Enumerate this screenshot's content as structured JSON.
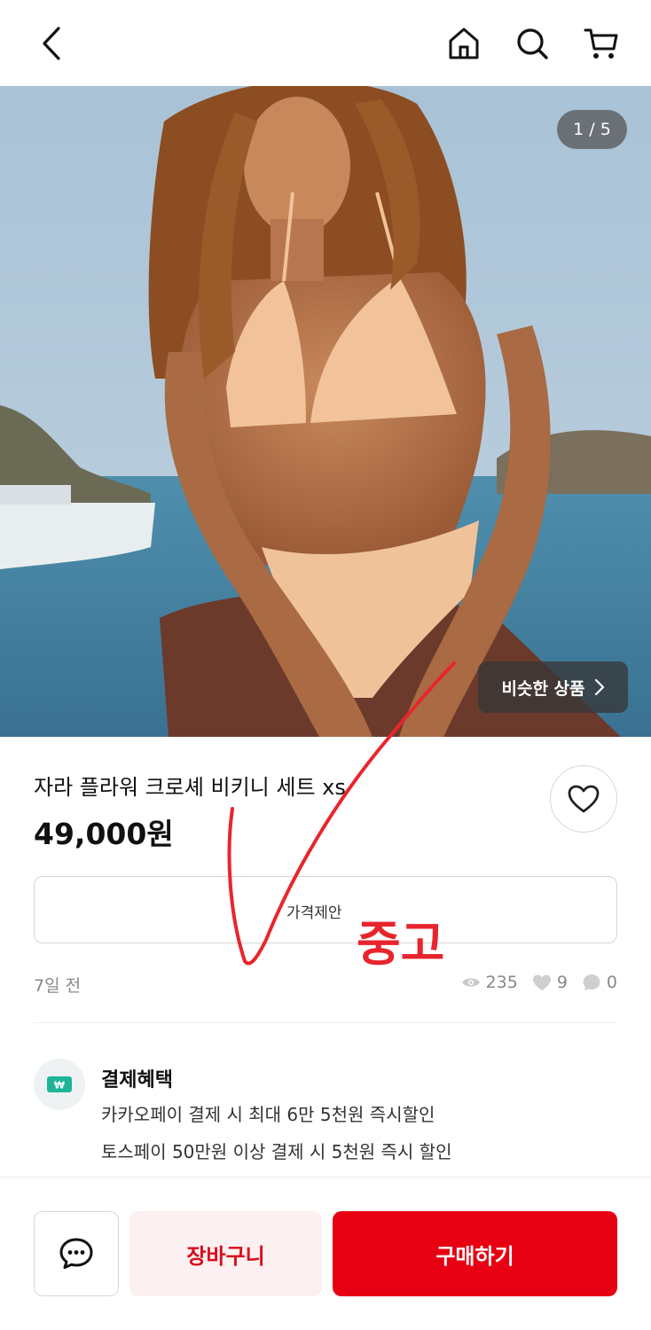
{
  "header": {
    "icons": [
      "back-icon",
      "home-icon",
      "search-icon",
      "cart-icon"
    ]
  },
  "gallery": {
    "counter": "1 / 5",
    "similar_label": "비슷한 상품",
    "similar_icon": "chevron-right-icon"
  },
  "product": {
    "title": "자라 플라워 크로셰 비키니 세트 xs",
    "price": "49,000원"
  },
  "offer_button": "가격제안",
  "meta": {
    "posted": "7일 전",
    "views": "235",
    "likes": "9",
    "chats": "0"
  },
  "benefit": {
    "title": "결제혜택",
    "lines": [
      "카카오페이 결제 시 최대 6만 5천원 즉시할인",
      "토스페이 50만원 이상 결제 시 5천원 즉시 할인"
    ]
  },
  "bottom_bar": {
    "cart_label": "장바구니",
    "buy_label": "구매하기"
  },
  "annotation": {
    "text": "중고"
  },
  "colors": {
    "accent": "#e60012",
    "cart_bg": "#fdf0f0",
    "annotation": "#e8252d"
  }
}
